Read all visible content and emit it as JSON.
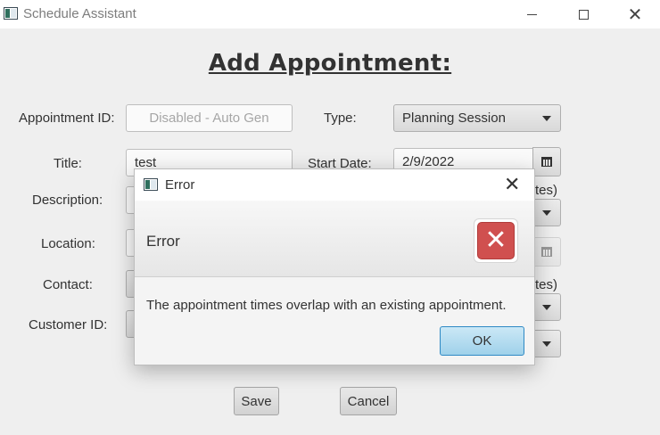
{
  "window": {
    "title": "Schedule Assistant",
    "minimize_glyph": "—",
    "maximize_glyph": "☐",
    "close_glyph": "✕"
  },
  "form": {
    "title": "Add Appointment:",
    "appointment_id": {
      "label": "Appointment ID:",
      "value": "Disabled - Auto Gen"
    },
    "title_field": {
      "label": "Title:",
      "value": "test"
    },
    "description": {
      "label": "Description:"
    },
    "location": {
      "label": "Location:"
    },
    "contact": {
      "label": "Contact:"
    },
    "customer_id": {
      "label": "Customer ID:"
    },
    "type": {
      "label": "Type:",
      "value": "Planning Session"
    },
    "start_date": {
      "label": "Start Date:",
      "value": "2/9/2022"
    },
    "partial_labels": {
      "start_time_suffix": "tes)",
      "end_time_suffix": "tes)"
    },
    "save_label": "Save",
    "cancel_label": "Cancel"
  },
  "dialog": {
    "title": "Error",
    "header_text": "Error",
    "content_text": "The appointment times overlap with an existing appointment.",
    "ok_label": "OK",
    "icon_glyph": "✕"
  },
  "colors": {
    "error_red": "#d0504f",
    "ok_button": "#9fd1ea",
    "ok_border": "#2e89c4"
  },
  "icons": [
    "app-icon",
    "minimize-icon",
    "maximize-icon",
    "close-icon",
    "calendar-icon",
    "dropdown-arrow-icon",
    "error-icon"
  ]
}
